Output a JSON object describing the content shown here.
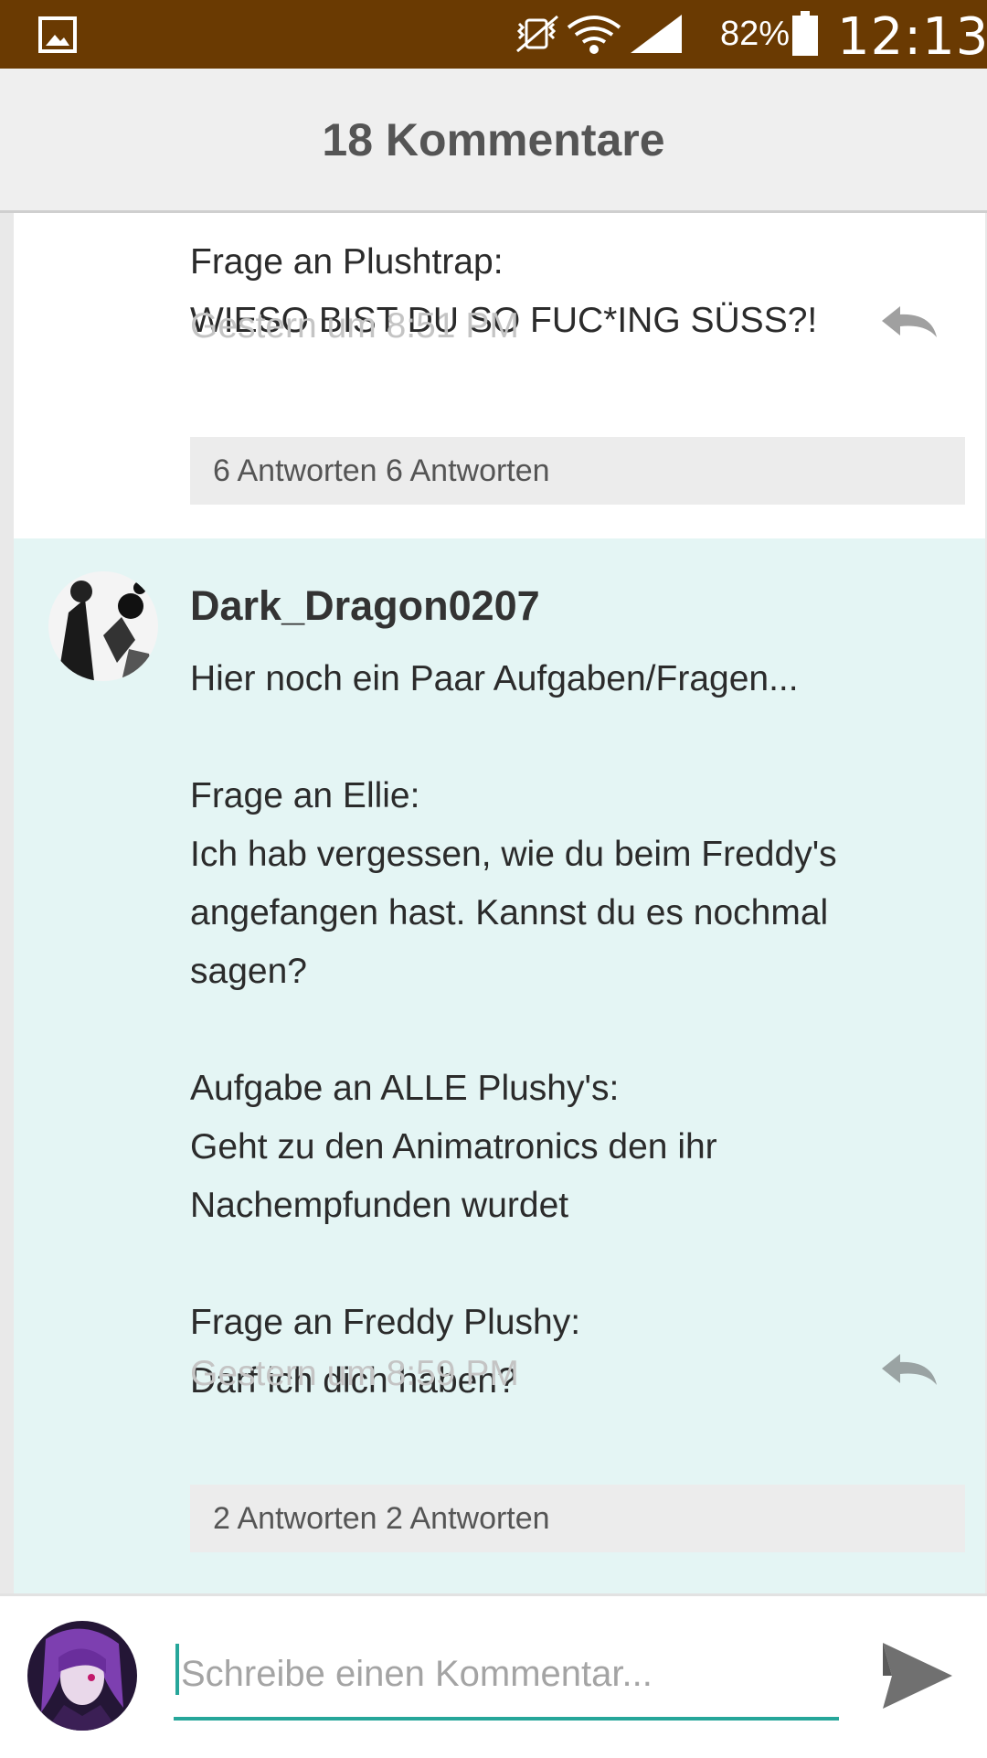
{
  "status_bar": {
    "battery_percent": "82%",
    "time": "12:13",
    "icons": [
      "gallery-icon",
      "vibrate-icon",
      "wifi-icon",
      "signal-icon",
      "battery-icon"
    ]
  },
  "header": {
    "title": "18 Kommentare"
  },
  "comments": [
    {
      "lines": [
        "Frage an Plushtrap:",
        "WIESO BIST DU SO FUC*ING SÜSS?!"
      ],
      "timestamp": "Gestern um 8:51 PM",
      "replies_label": "6 Antworten 6 Antworten"
    },
    {
      "username": "Dark_Dragon0207",
      "lines": [
        "Hier noch ein Paar Aufgaben/Fragen...",
        "",
        "Frage an Ellie:",
        "Ich hab vergessen, wie du beim Freddy's",
        "angefangen hast. Kannst du es nochmal",
        "sagen?",
        "",
        "Aufgabe an ALLE Plushy's:",
        "Geht zu den Animatronics den ihr",
        "Nachempfunden wurdet",
        "",
        "Frage an Freddy Plushy:",
        "Darf ich dich haben?"
      ],
      "timestamp": "Gestern um 8:59 PM",
      "replies_label": "2 Antworten 2 Antworten"
    }
  ],
  "composer": {
    "placeholder": "Schreibe einen Kommentar..."
  },
  "colors": {
    "status_bar": "#6a3a02",
    "highlight_bg": "#e4f5f4",
    "accent": "#26a69a"
  }
}
